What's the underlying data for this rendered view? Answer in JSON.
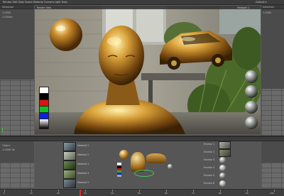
{
  "app": {
    "menubar_left": "Render  Edit  View  Scene  Material  Camera  Light  Help",
    "menubar_right": "Default  ▾"
  },
  "viewport": {
    "toolbar_label": "Render View",
    "toolbar_right": "Viewport 1"
  },
  "left_panel": {
    "header": "Selection",
    "field_1": "1.0000",
    "field_2": "1.00/sec"
  },
  "right_panel": {
    "header": "Selection",
    "field_1": "1.0000"
  },
  "swatches": {
    "colors": [
      "#ffffff",
      "#000000",
      "#e01010",
      "#10c020",
      "#1020e0",
      "#c8c8c8"
    ]
  },
  "bottom_panel": {
    "left_field": "Object",
    "left_value": "1.0000 Hz"
  },
  "thumbnails": {
    "left": [
      {
        "label": "Material 1"
      },
      {
        "label": "Material 2"
      },
      {
        "label": "Material 3"
      },
      {
        "label": "Material 4"
      },
      {
        "label": "Material 5"
      }
    ],
    "right": [
      {
        "label": "Environ 1"
      },
      {
        "label": "Environ 2"
      },
      {
        "label": "Environ 3"
      },
      {
        "label": "Environ 4"
      },
      {
        "label": "Environ 5"
      },
      {
        "label": "Environ 6"
      }
    ]
  },
  "timeline": {
    "ticks": [
      "0",
      "10",
      "20",
      "30",
      "40",
      "50",
      "60",
      "70",
      "80",
      "90",
      "100"
    ],
    "current_frame": "0"
  }
}
